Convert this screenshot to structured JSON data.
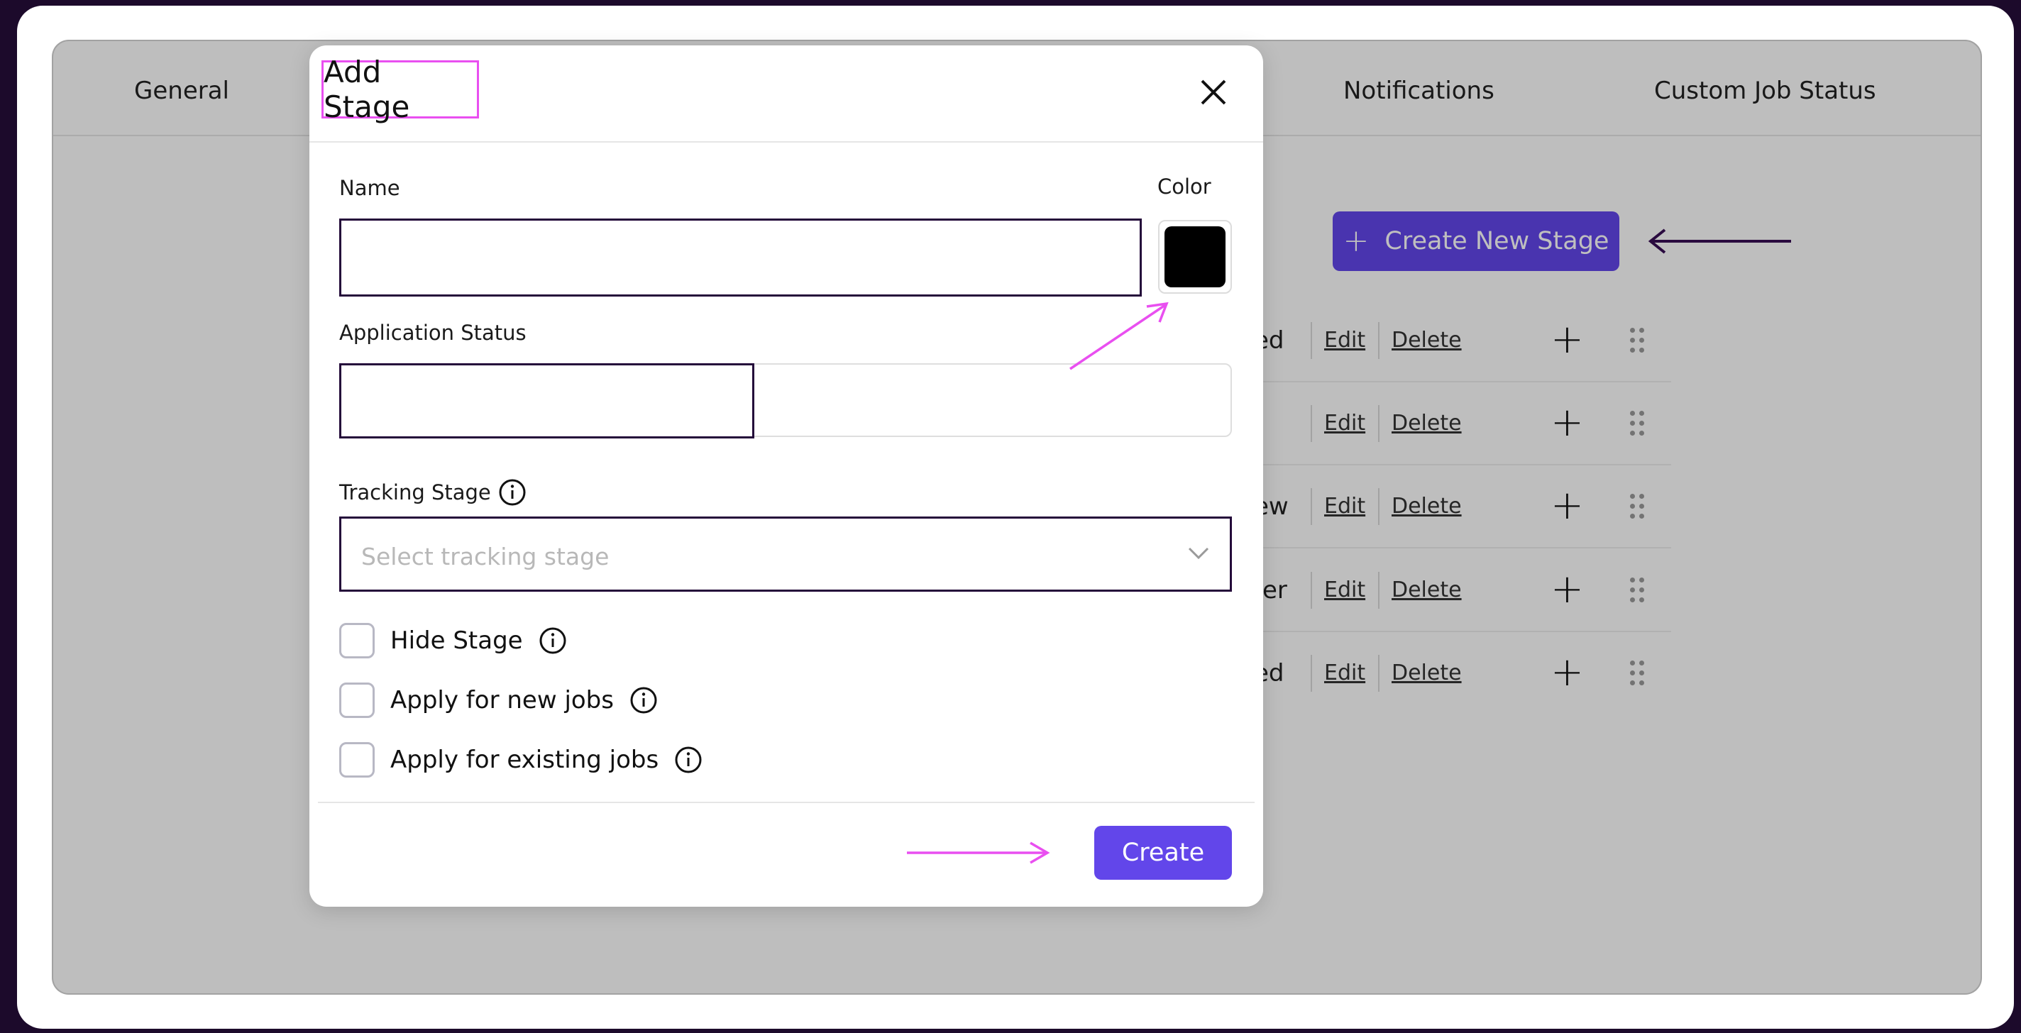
{
  "app": {
    "tabs": [
      "General",
      "Notifications",
      "Custom Job Status"
    ],
    "create_stage_button": "Create New Stage",
    "accent_color": "#6246ea",
    "stages": [
      {
        "name_fragment": "ed",
        "edit": "Edit",
        "delete": "Delete"
      },
      {
        "name_fragment": "",
        "edit": "Edit",
        "delete": "Delete"
      },
      {
        "name_fragment": "ew",
        "edit": "Edit",
        "delete": "Delete"
      },
      {
        "name_fragment": "fer",
        "edit": "Edit",
        "delete": "Delete"
      },
      {
        "name_fragment": "ed",
        "edit": "Edit",
        "delete": "Delete"
      }
    ]
  },
  "modal": {
    "title": "Add Stage",
    "name_label": "Name",
    "name_value": "",
    "color_label": "Color",
    "selected_color": "#000000",
    "application_status_label": "Application Status",
    "application_status_value": "",
    "tracking_stage_label": "Tracking Stage",
    "tracking_stage_placeholder": "Select tracking stage",
    "checkboxes": [
      {
        "label": "Hide Stage",
        "checked": false
      },
      {
        "label": "Apply for new jobs",
        "checked": false
      },
      {
        "label": "Apply for existing jobs",
        "checked": false
      }
    ],
    "create_button": "Create"
  },
  "annotation_color": "#e94ff0"
}
